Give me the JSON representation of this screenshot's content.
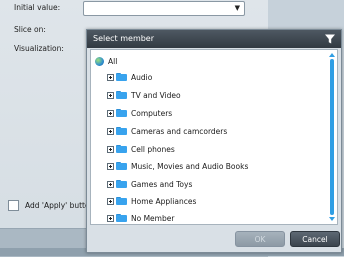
{
  "settings": {
    "initial_value_label": "Initial value:",
    "slice_on_label": "Slice on:",
    "visualization_label": "Visualization:",
    "apply_label": "Add 'Apply' butto"
  },
  "dialog": {
    "title": "Select member",
    "root_label": "All",
    "items": [
      {
        "label": "Audio"
      },
      {
        "label": "TV and Video"
      },
      {
        "label": "Computers"
      },
      {
        "label": "Cameras and camcorders"
      },
      {
        "label": "Cell phones"
      },
      {
        "label": "Music, Movies and Audio Books"
      },
      {
        "label": "Games and Toys"
      },
      {
        "label": "Home Appliances"
      },
      {
        "label": "No Member"
      }
    ],
    "ok_label": "OK",
    "cancel_label": "Cancel"
  },
  "icons": {
    "filter": "funnel-icon",
    "root": "globe-icon",
    "item": "folder-icon",
    "expander": "expand-plus-icon",
    "dropdown": "chevron-down-icon"
  },
  "colors": {
    "header_bg": "#3f4850",
    "folder": "#38a3ee",
    "scrollbar": "#2f9ee4",
    "cancel_bg": "#4a545e"
  }
}
